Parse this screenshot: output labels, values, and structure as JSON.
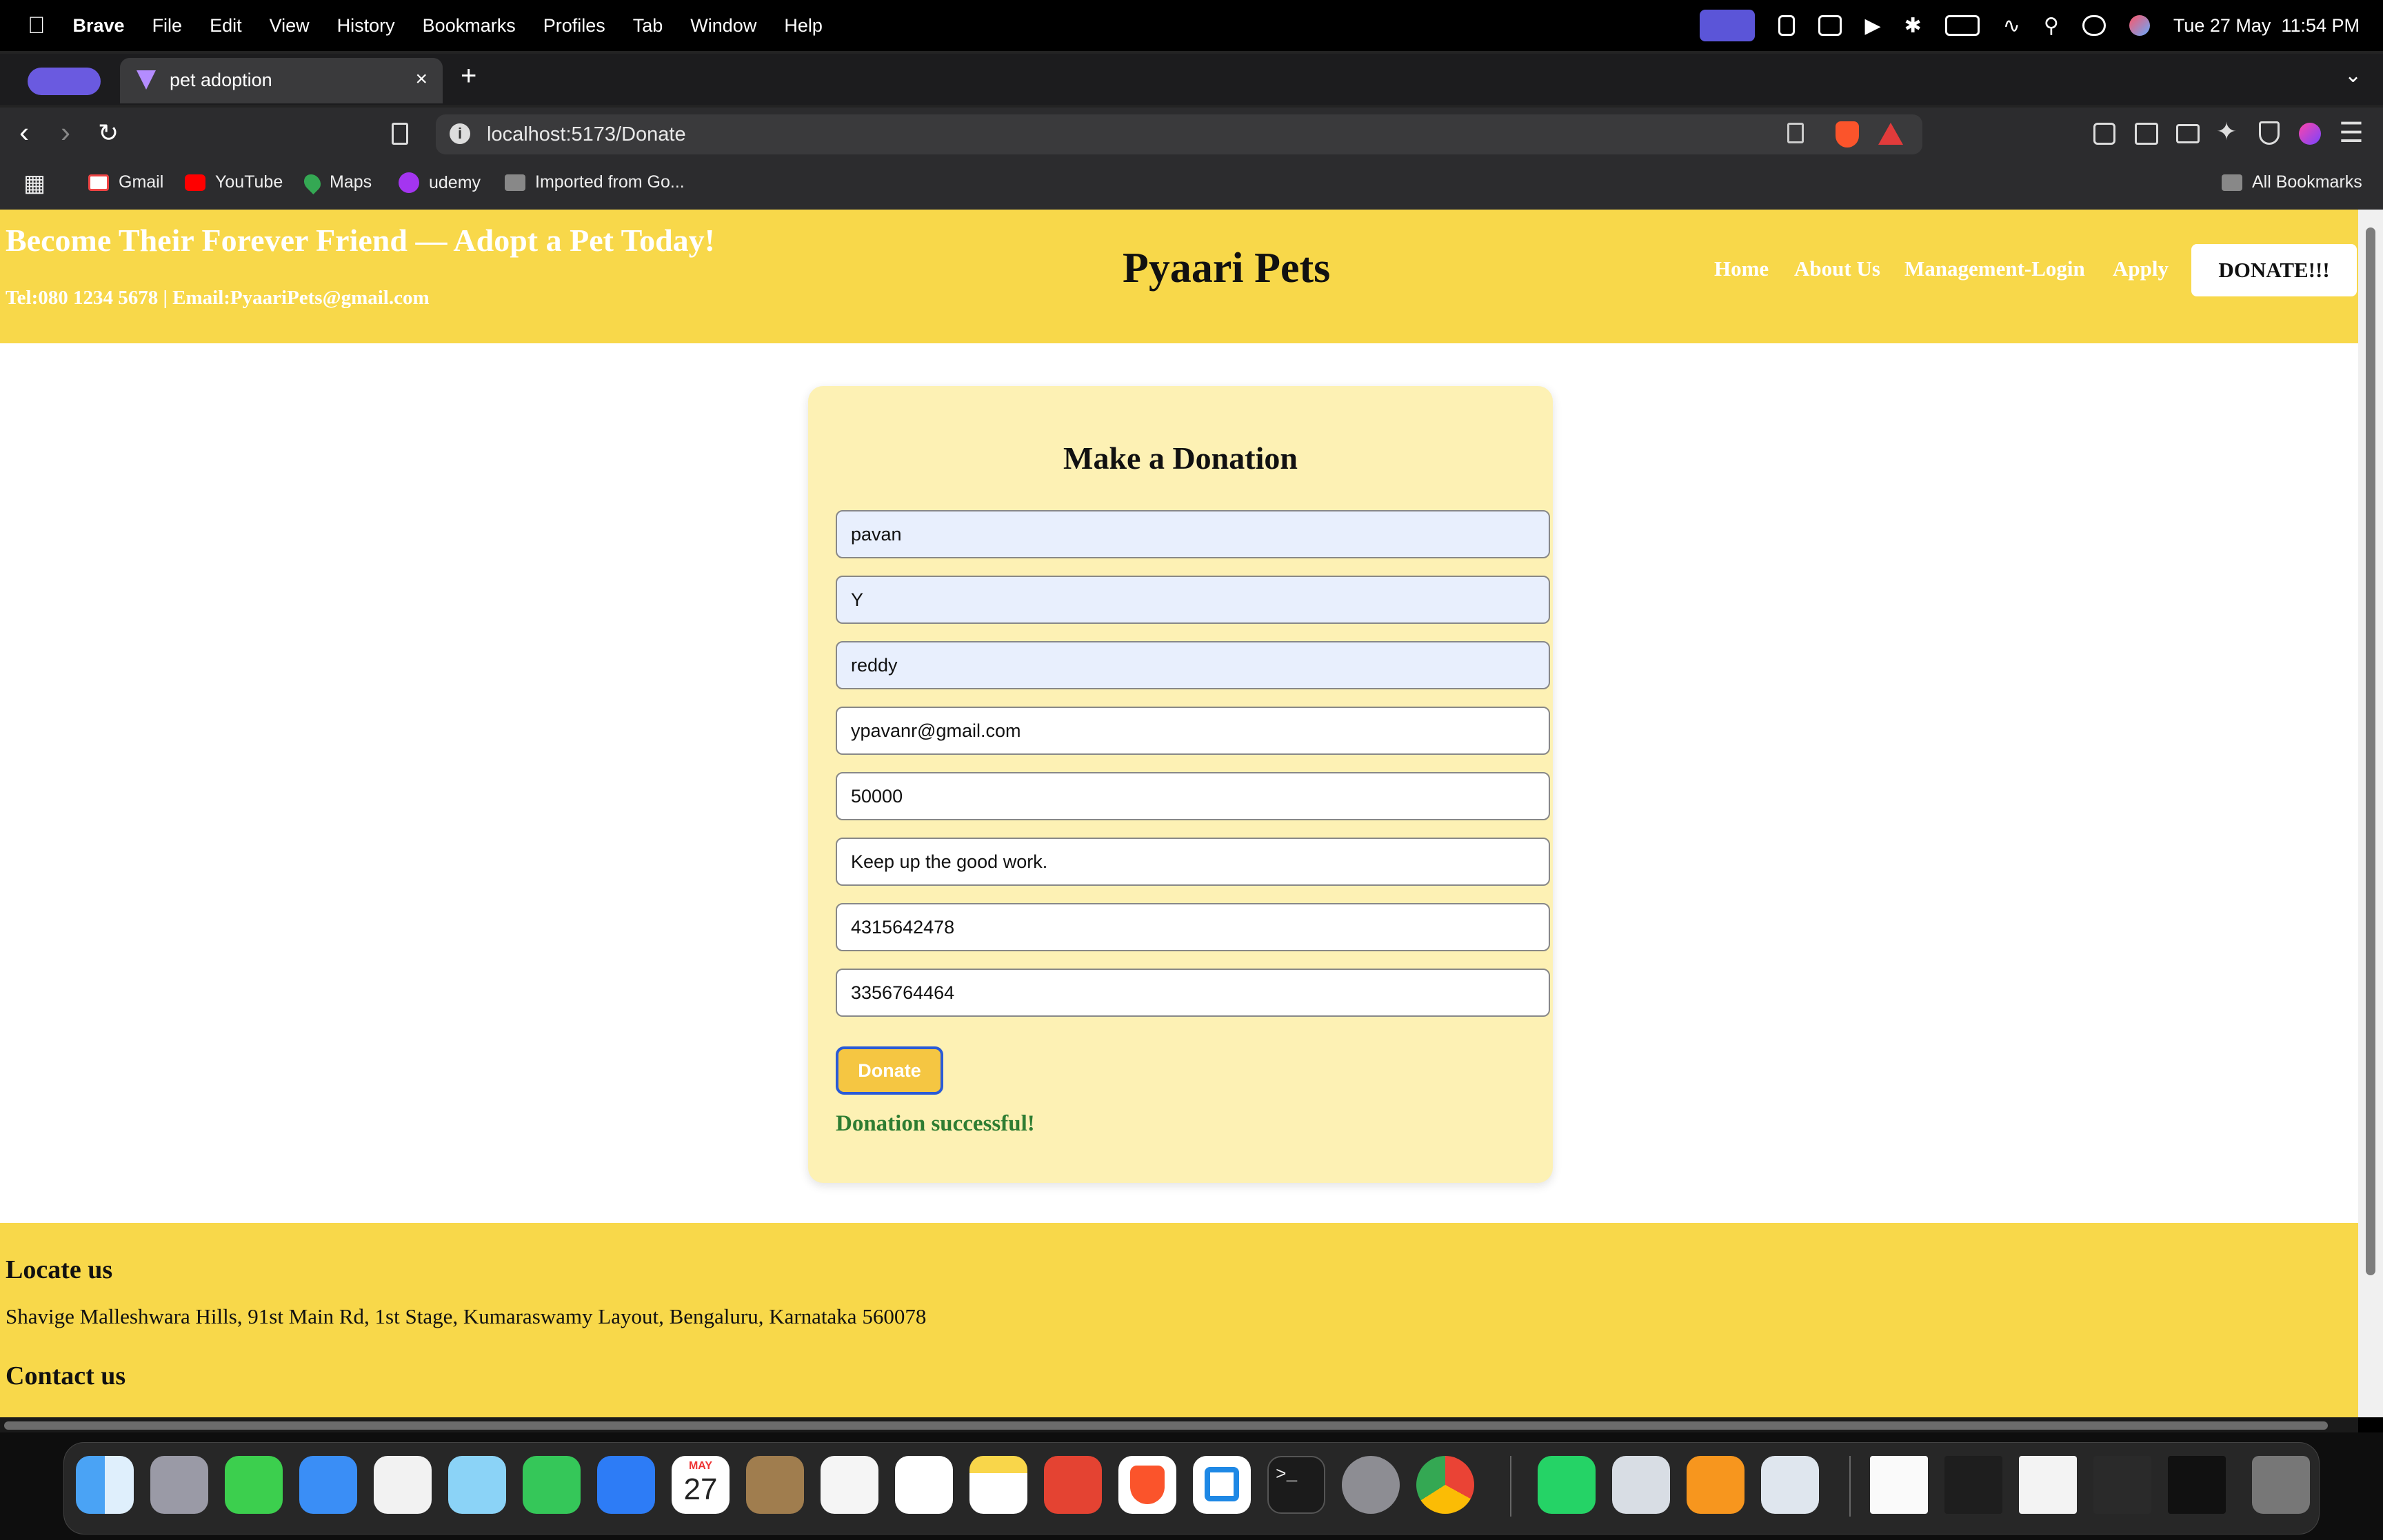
{
  "menubar": {
    "app_name": "Brave",
    "menus": [
      "File",
      "Edit",
      "View",
      "History",
      "Bookmarks",
      "Profiles",
      "Tab",
      "Window",
      "Help"
    ],
    "datetime": "Tue 27 May  11:54 PM"
  },
  "browser": {
    "tab_title": "pet adoption",
    "tab_close": "×",
    "new_tab": "+",
    "url": "localhost:5173/Donate",
    "bookmarks": [
      "Gmail",
      "YouTube",
      "Maps",
      "udemy",
      "Imported from Go..."
    ],
    "all_bookmarks": "All Bookmarks"
  },
  "header": {
    "tagline": "Become Their Forever Friend — Adopt a Pet Today!",
    "contact": "Tel:080 1234 5678 | Email:PyaariPets@gmail.com",
    "brand": "Pyaari Pets",
    "nav": [
      "Home",
      "About Us",
      "Management-Login",
      "Apply"
    ],
    "donate_button": "DONATE!!!"
  },
  "form": {
    "title": "Make a Donation",
    "fields": [
      {
        "value": "pavan",
        "autofilled": true
      },
      {
        "value": "Y",
        "autofilled": true
      },
      {
        "value": "reddy",
        "autofilled": true
      },
      {
        "value": "ypavanr@gmail.com",
        "autofilled": false
      },
      {
        "value": "50000",
        "autofilled": false
      },
      {
        "value": "Keep up the good work.",
        "autofilled": false
      },
      {
        "value": "4315642478",
        "autofilled": false
      },
      {
        "value": "3356764464",
        "autofilled": false
      }
    ],
    "submit_label": "Donate",
    "success_message": "Donation successful!"
  },
  "footer": {
    "locate_heading": "Locate us",
    "address": "Shavige Malleshwara Hills, 91st Main Rd, 1st Stage, Kumaraswamy Layout, Bengaluru, Karnataka 560078",
    "contact_heading": "Contact us"
  },
  "dock": {
    "calendar_month": "MAY",
    "calendar_day": "27"
  },
  "colors": {
    "header_yellow": "#f8d84a",
    "card_bg": "#fdf1b4",
    "success_green": "#2e7d32",
    "button_yellow": "#f5c642",
    "focus_blue": "#2a5bd7"
  }
}
